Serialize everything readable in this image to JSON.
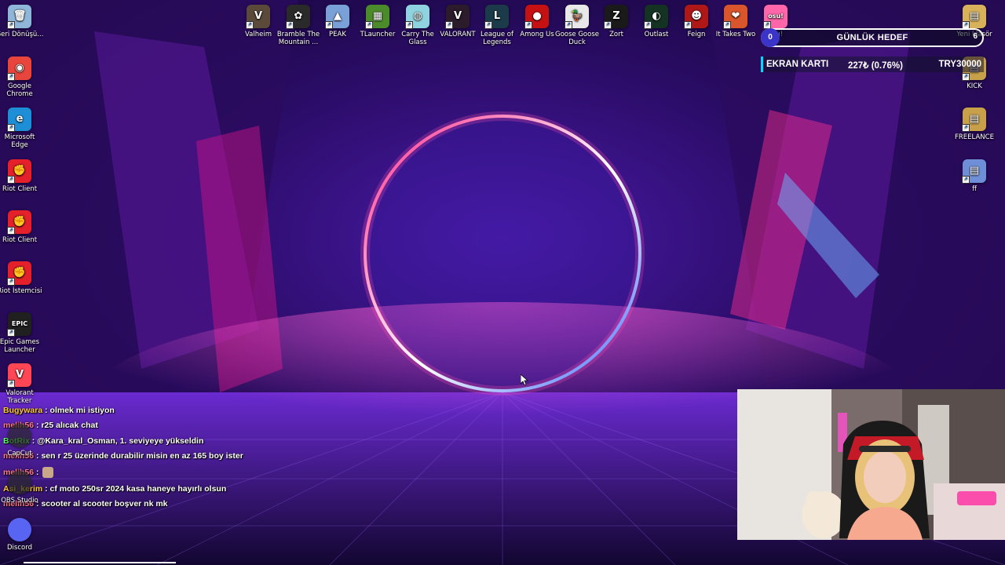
{
  "desktop_left": [
    {
      "label": "Geri Dönüşü...",
      "icon": "recycle-bin-icon",
      "color": "#8fb6d9",
      "glyph": "🗑"
    },
    {
      "label": "Google Chrome",
      "icon": "chrome-icon",
      "color": "#e8453c",
      "glyph": "◉"
    },
    {
      "label": "Microsoft Edge",
      "icon": "edge-icon",
      "color": "#1e8fd6",
      "glyph": "e"
    },
    {
      "label": "Riot Client",
      "icon": "riot-client-icon",
      "color": "#e4202a",
      "glyph": "✊"
    },
    {
      "label": "Riot Client",
      "icon": "riot-client-icon",
      "color": "#e4202a",
      "glyph": "✊"
    },
    {
      "label": "Riot İstemcisi",
      "icon": "riot-client-icon",
      "color": "#e4202a",
      "glyph": "✊"
    },
    {
      "label": "Epic Games Launcher",
      "icon": "epic-games-icon",
      "color": "#202020",
      "glyph": "EPIC"
    },
    {
      "label": "Valorant Tracker",
      "icon": "valorant-tracker-icon",
      "color": "#ff4655",
      "glyph": "V"
    }
  ],
  "desktop_left_bottom": [
    {
      "label": "CapCut",
      "icon": "capcut-icon"
    },
    {
      "label": "OBS Studio",
      "icon": "obs-studio-icon"
    },
    {
      "label": "Discord",
      "icon": "discord-icon",
      "color": "#5865f2"
    }
  ],
  "desktop_top": [
    {
      "label": "Valheim",
      "icon": "valheim-icon",
      "color": "#5b4a3a",
      "glyph": "V"
    },
    {
      "label": "Bramble The Mountain ...",
      "icon": "bramble-icon",
      "color": "#2a2a2a",
      "glyph": "✿"
    },
    {
      "label": "PEAK",
      "icon": "peak-icon",
      "color": "#7aa0d8",
      "glyph": "▲"
    },
    {
      "label": "TLauncher",
      "icon": "tlauncher-icon",
      "color": "#4c8b2b",
      "glyph": "▦"
    },
    {
      "label": "Carry The Glass",
      "icon": "carry-the-glass-icon",
      "color": "#8fd3e0",
      "glyph": "◍"
    },
    {
      "label": "VALORANT",
      "icon": "valorant-icon",
      "color": "#2b1b2b",
      "glyph": "V"
    },
    {
      "label": "League of Legends",
      "icon": "league-of-legends-icon",
      "color": "#1c3b4a",
      "glyph": "L"
    },
    {
      "label": "Among Us",
      "icon": "among-us-icon",
      "color": "#c51111",
      "glyph": "●"
    },
    {
      "label": "Goose Goose Duck",
      "icon": "goose-goose-duck-icon",
      "color": "#e8e8e8",
      "glyph": "🦆"
    },
    {
      "label": "Zort",
      "icon": "zort-icon",
      "color": "#1a1a1a",
      "glyph": "Z"
    },
    {
      "label": "Outlast",
      "icon": "outlast-icon",
      "color": "#143322",
      "glyph": "◐"
    },
    {
      "label": "Feign",
      "icon": "feign-icon",
      "color": "#b01717",
      "glyph": "☻"
    },
    {
      "label": "It Takes Two",
      "icon": "it-takes-two-icon",
      "color": "#d9552b",
      "glyph": "❤"
    },
    {
      "label": "osu!",
      "icon": "osu-icon",
      "color": "#ff66aa",
      "glyph": "osu!"
    }
  ],
  "desktop_right": [
    {
      "label": "Yeni klasör",
      "icon": "folder-icon",
      "color": "#d8b25a",
      "glyph": "▤"
    },
    {
      "label": "KICK",
      "icon": "kick-file-icon",
      "color": "#c9a04a",
      "glyph": "▤"
    },
    {
      "label": "FREELANCE",
      "icon": "freelance-file-icon",
      "color": "#c9a04a",
      "glyph": "▤"
    },
    {
      "label": "ff",
      "icon": "ff-file-icon",
      "color": "#6e8fd8",
      "glyph": "▤"
    }
  ],
  "goal": {
    "count": "0",
    "label": "GÜNLÜK HEDEF",
    "right_mark": "6"
  },
  "ekran": {
    "name": "EKRAN KARTI",
    "progress": "227₺ (0.76%)",
    "target": "TRY30000"
  },
  "chat": [
    {
      "user": "Bugywara",
      "sep": " : ",
      "text": "olmek mi istiyon",
      "user_color": "yellow"
    },
    {
      "user": "melih56",
      "sep": " : ",
      "text": "r25 alıcak chat",
      "user_color": "pink"
    },
    {
      "user": "BotRix",
      "sep": " : ",
      "text": "@Kara_kral_Osman, 1. seviyeye yükseldin",
      "user_color": "green"
    },
    {
      "user": "melih56",
      "sep": " : ",
      "text": "sen r 25 üzerinde durabilir misin en az 165 boy ister",
      "user_color": "pink"
    },
    {
      "user": "melih56",
      "sep": " : ",
      "text": "",
      "user_color": "pink"
    },
    {
      "user": "Asi_kerim",
      "sep": " : ",
      "text": "cf moto 250sr 2024 kasa haneye hayırlı olsun",
      "user_color": "yellow"
    },
    {
      "user": "melih56",
      "sep": " : ",
      "text": "scooter al scooter boşver nk mk",
      "user_color": "pink"
    }
  ],
  "colors": {
    "accent_cyan": "#00d8ff",
    "ring_pink": "#ff2a8a",
    "ring_blue": "#3a6bff"
  }
}
